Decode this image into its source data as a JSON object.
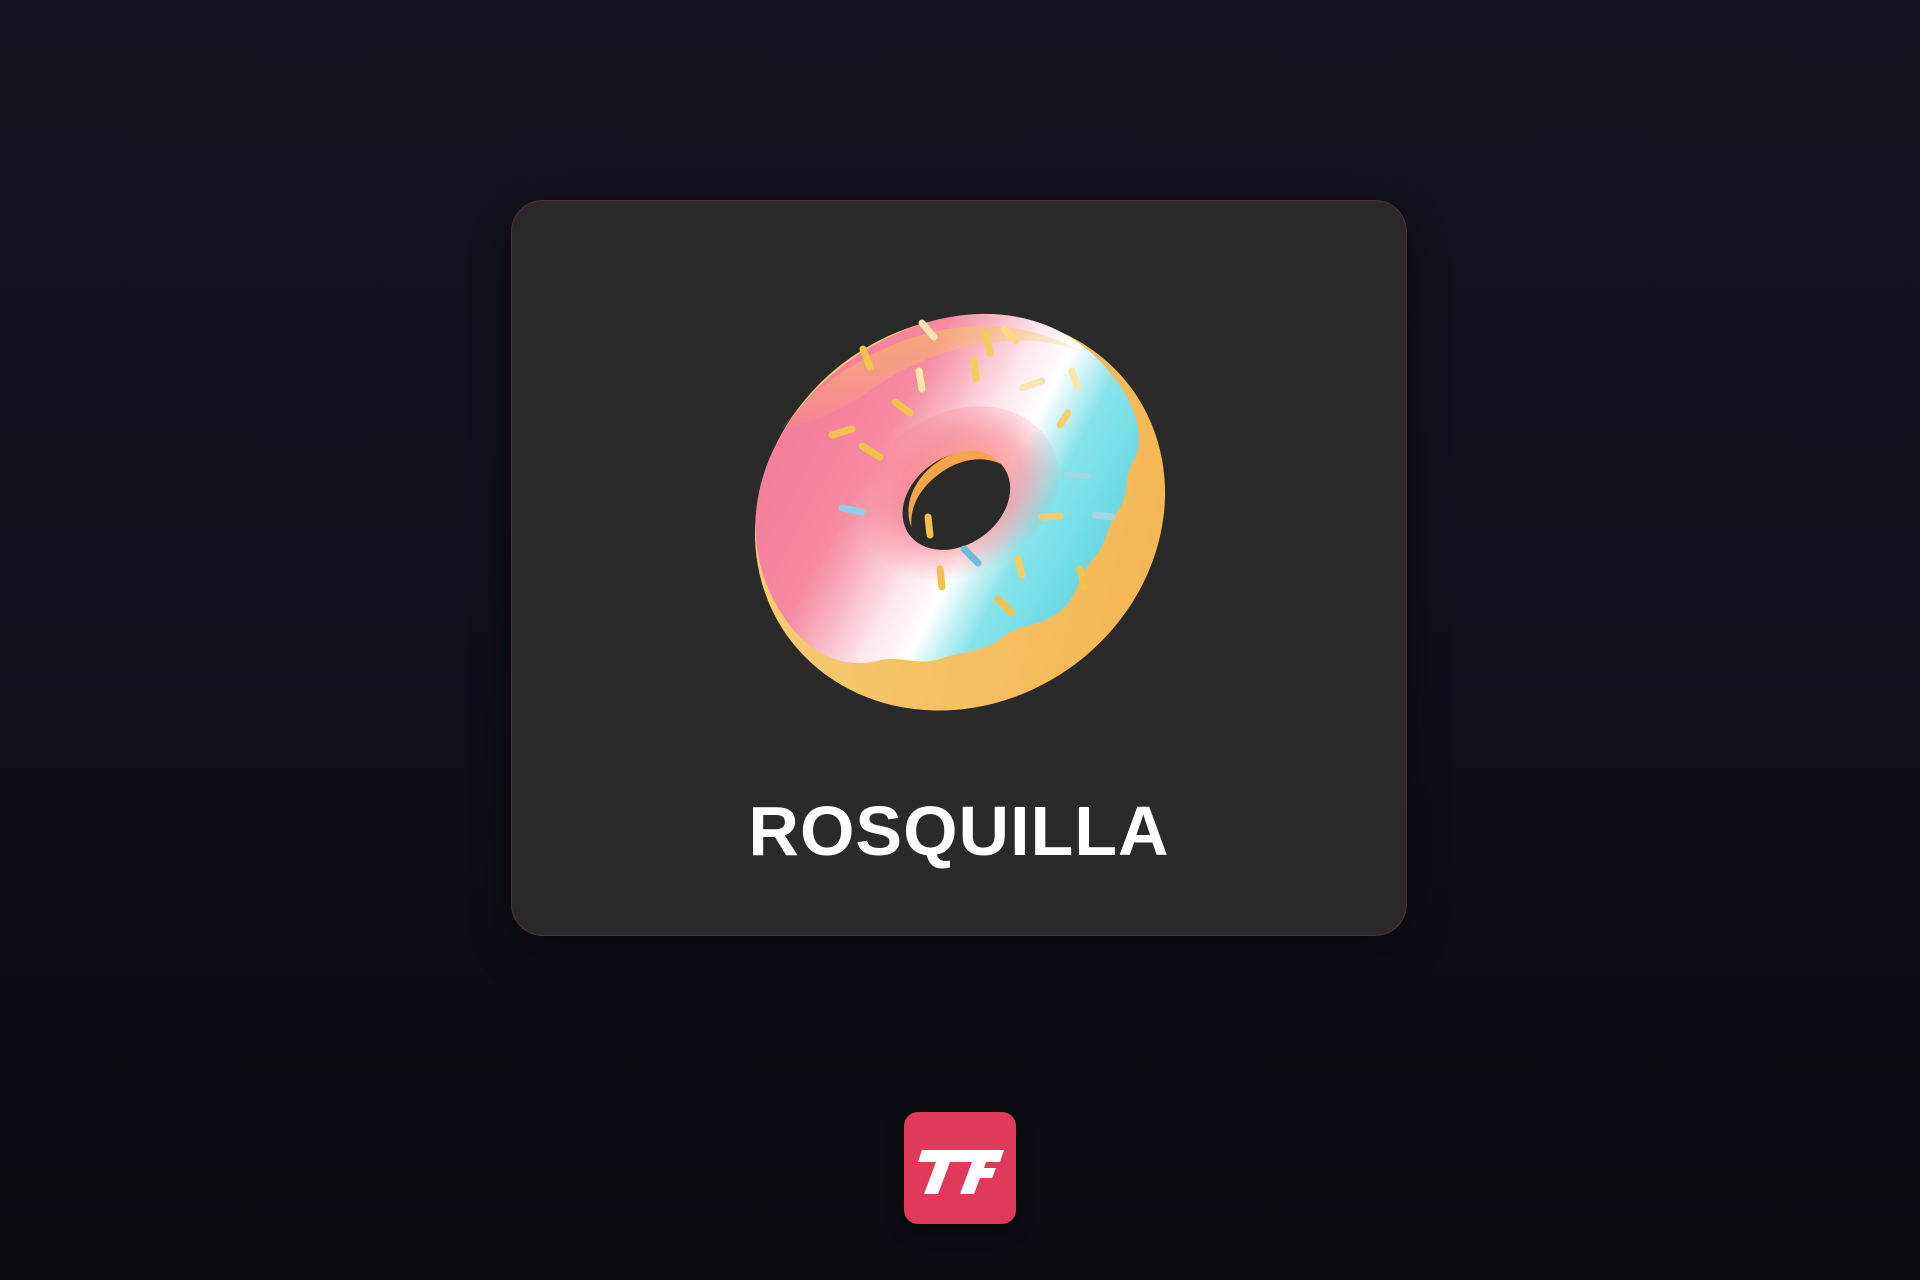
{
  "card": {
    "title": "ROSQUILLA",
    "image_icon": "donut-icon"
  },
  "brand": {
    "logo_icon": "brand-logo-icon",
    "color": "#e03a5a"
  },
  "colors": {
    "background": "#12131b",
    "card": "#2a2a2a",
    "card_border": "#5a2a33",
    "title": "#ffffff"
  }
}
